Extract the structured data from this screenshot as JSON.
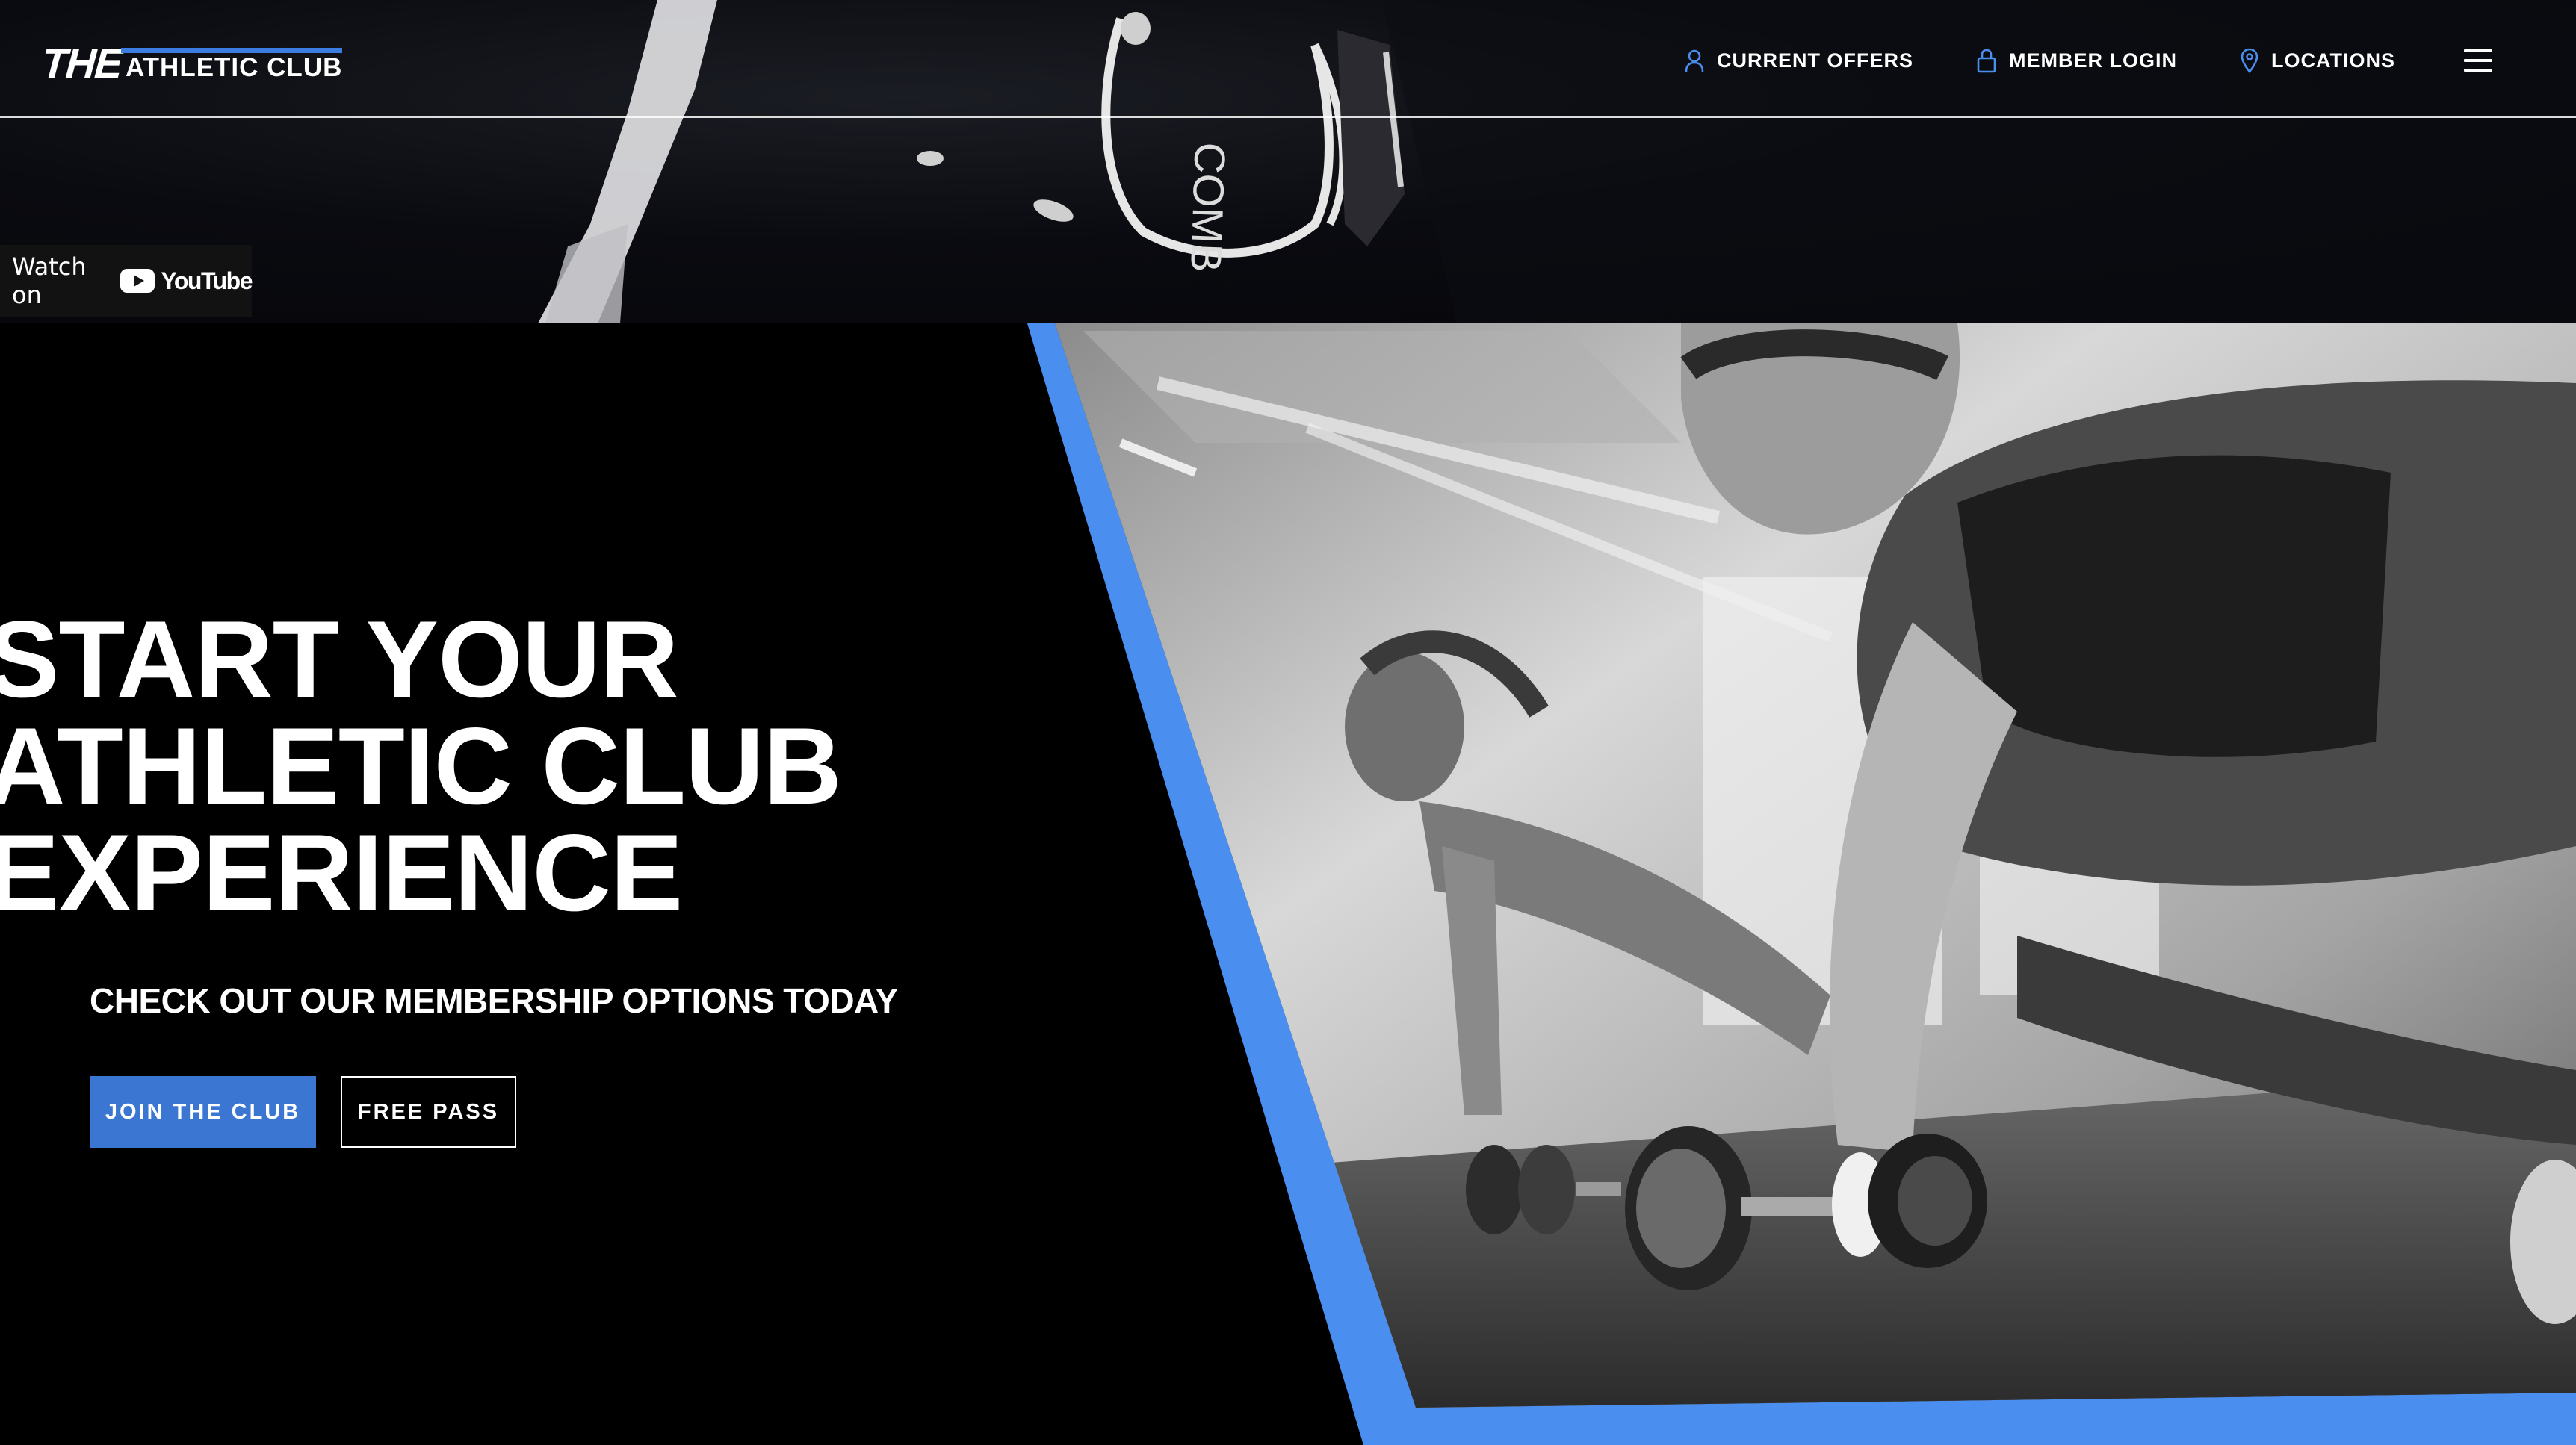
{
  "header": {
    "logo": {
      "the": "THE",
      "rest": "ATHLETIC CLUB"
    },
    "nav": [
      {
        "label": "CURRENT OFFERS",
        "icon": "user-icon"
      },
      {
        "label": "MEMBER LOGIN",
        "icon": "lock-icon"
      },
      {
        "label": "LOCATIONS",
        "icon": "map-pin-icon"
      }
    ],
    "menu_icon": "hamburger-menu-icon"
  },
  "video": {
    "watch_on": "Watch on",
    "platform": "YouTube",
    "glove_text": "COMB"
  },
  "hero": {
    "headline": [
      "START YOUR",
      "ATHLETIC CLUB",
      "EXPERIENCE"
    ],
    "subheadline": "CHECK OUT OUR MEMBERSHIP OPTIONS TODAY",
    "buttons": {
      "join": "JOIN THE CLUB",
      "free_pass": "FREE PASS"
    },
    "image_description_icon": "gym-pushup-photo"
  },
  "colors": {
    "accent": "#3a76d2",
    "accent_bright": "#4a8ff0",
    "background": "#000000",
    "text": "#ffffff"
  }
}
